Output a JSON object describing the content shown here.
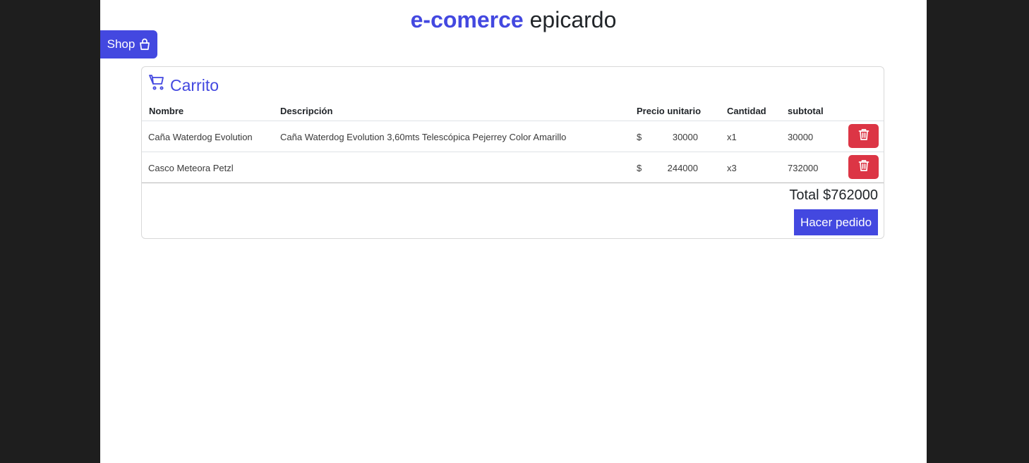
{
  "header": {
    "brand": "e-comerce",
    "name": "epicardo"
  },
  "nav": {
    "shop_label": "Shop",
    "shop_icon": "hand-bag-icon"
  },
  "cart": {
    "title": "Carrito",
    "title_icon": "cart-icon",
    "columns": [
      "Nombre",
      "Descripción",
      "Precio unitario",
      "Cantidad",
      "subtotal"
    ],
    "rows": [
      {
        "name": "Caña Waterdog Evolution",
        "description": "Caña Waterdog Evolution 3,60mts Telescópica Pejerrey Color Amarillo",
        "currency": "$",
        "unit_price": "30000",
        "quantity": "x1",
        "subtotal": "30000"
      },
      {
        "name": "Casco Meteora Petzl",
        "description": "",
        "currency": "$",
        "unit_price": "244000",
        "quantity": "x3",
        "subtotal": "732000"
      }
    ],
    "total": "Total $762000",
    "order_label": "Hacer pedido"
  },
  "colors": {
    "accent": "#4348e0",
    "danger": "#dc3545",
    "background": "#1e1e1e"
  }
}
